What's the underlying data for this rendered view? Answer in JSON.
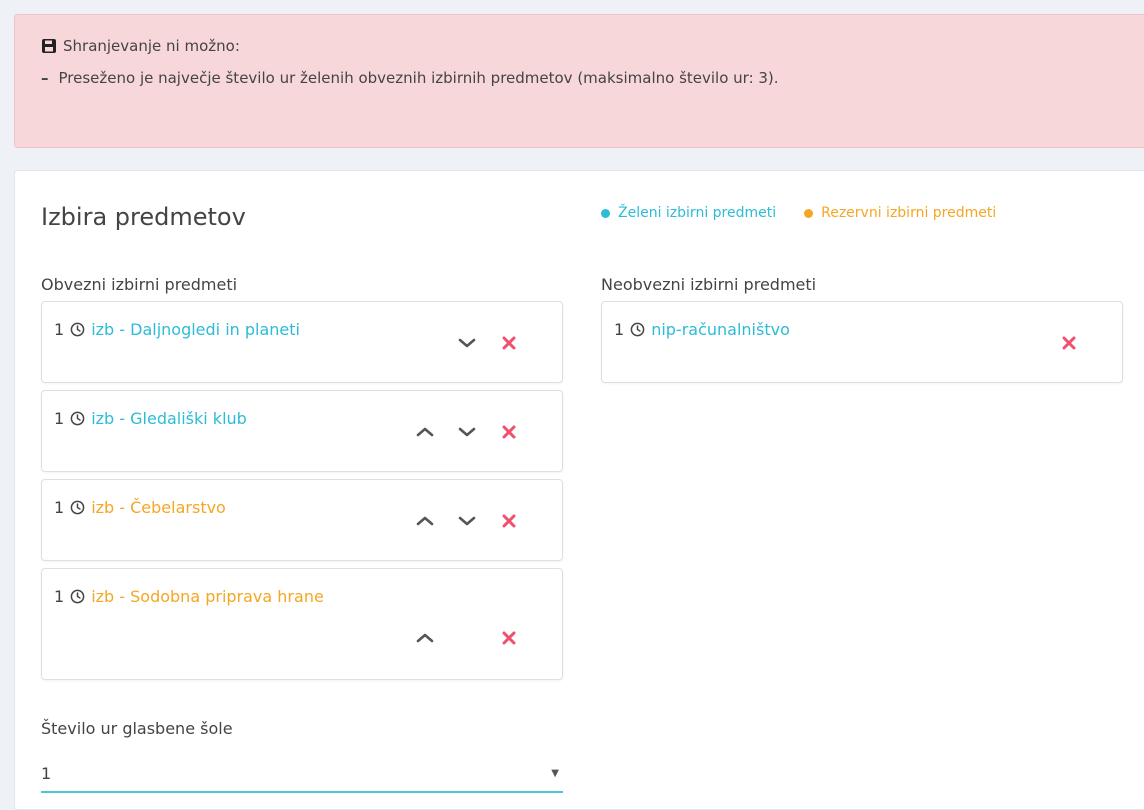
{
  "alert": {
    "title": "Shranjevanje ni možno:",
    "dash": "–",
    "message": "Preseženo je največje število ur želenih obveznih izbirnih predmetov (maksimalno število ur: 3)."
  },
  "card": {
    "title": "Izbira predmetov",
    "legend": [
      {
        "label": "Želeni izbirni predmeti",
        "color": "#2cbcd6"
      },
      {
        "label": "Rezervni izbirni predmeti",
        "color": "#f5a623"
      }
    ],
    "mandatory_label": "Obvezni izbirni predmeti",
    "optional_label": "Neobvezni izbirni predmeti",
    "mandatory": [
      {
        "hours": "1",
        "name": "izb - Daljnogledi in planeti",
        "type": "wanted"
      },
      {
        "hours": "1",
        "name": "izb - Gledališki klub",
        "type": "wanted"
      },
      {
        "hours": "1",
        "name": "izb - Čebelarstvo",
        "type": "reserve"
      },
      {
        "hours": "1",
        "name": "izb - Sodobna priprava hrane",
        "type": "reserve"
      }
    ],
    "optional": [
      {
        "hours": "1",
        "name": "nip-računalništvo",
        "type": "wanted"
      }
    ],
    "music_school_label": "Število ur glasbene šole",
    "music_school_value": "1"
  },
  "colors": {
    "wanted": "#2cbcd6",
    "reserve": "#f5a623",
    "remove": "#f0506e",
    "arrow": "#555555"
  }
}
